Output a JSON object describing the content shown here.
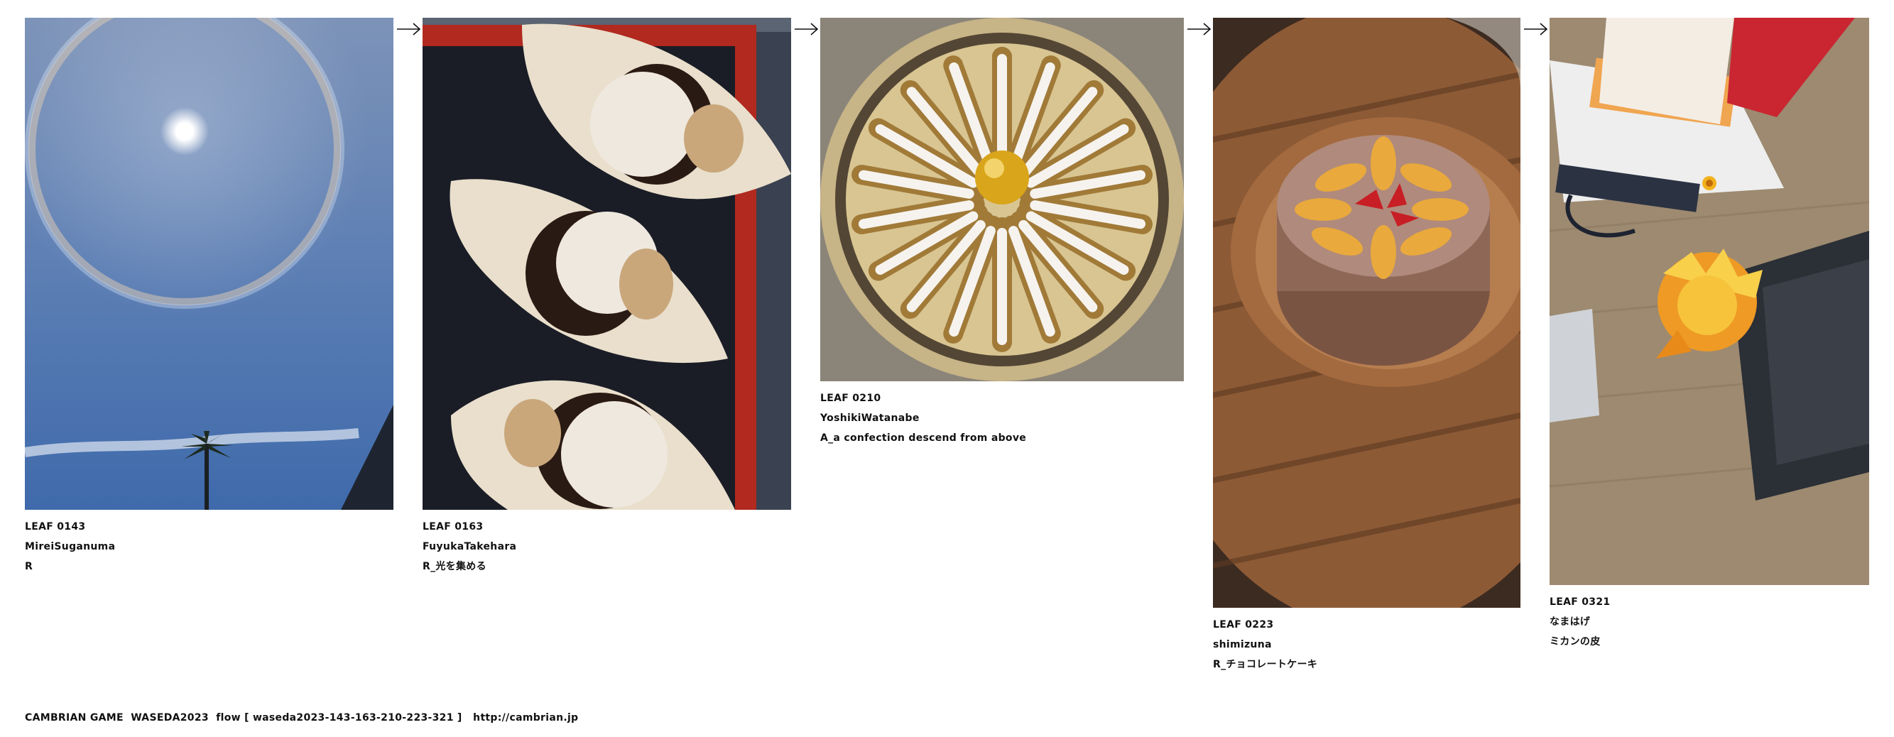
{
  "leaves": [
    {
      "id": "LEAF 0143",
      "author": "MireiSuganuma",
      "title": "R"
    },
    {
      "id": "LEAF 0163",
      "author": "FuyukaTakehara",
      "title": "R_光を集める"
    },
    {
      "id": "LEAF 0210",
      "author": "YoshikiWatanabe",
      "title": "A_a confection descend from above"
    },
    {
      "id": "LEAF 0223",
      "author": "shimizuna",
      "title": "R_チョコレートケーキ"
    },
    {
      "id": "LEAF 0321",
      "author": "なまはげ",
      "title": "ミカンの皮"
    }
  ],
  "footer": {
    "text": "CAMBRIAN GAME  WASEDA2023  flow [ waseda2023-143-163-210-223-321 ]",
    "link": "http://cambrian.jp"
  },
  "colors": {
    "sky": "#5f7fb0",
    "tray": "#1c1f2a",
    "wood": "#8a5a38",
    "desk": "#9a8466"
  }
}
